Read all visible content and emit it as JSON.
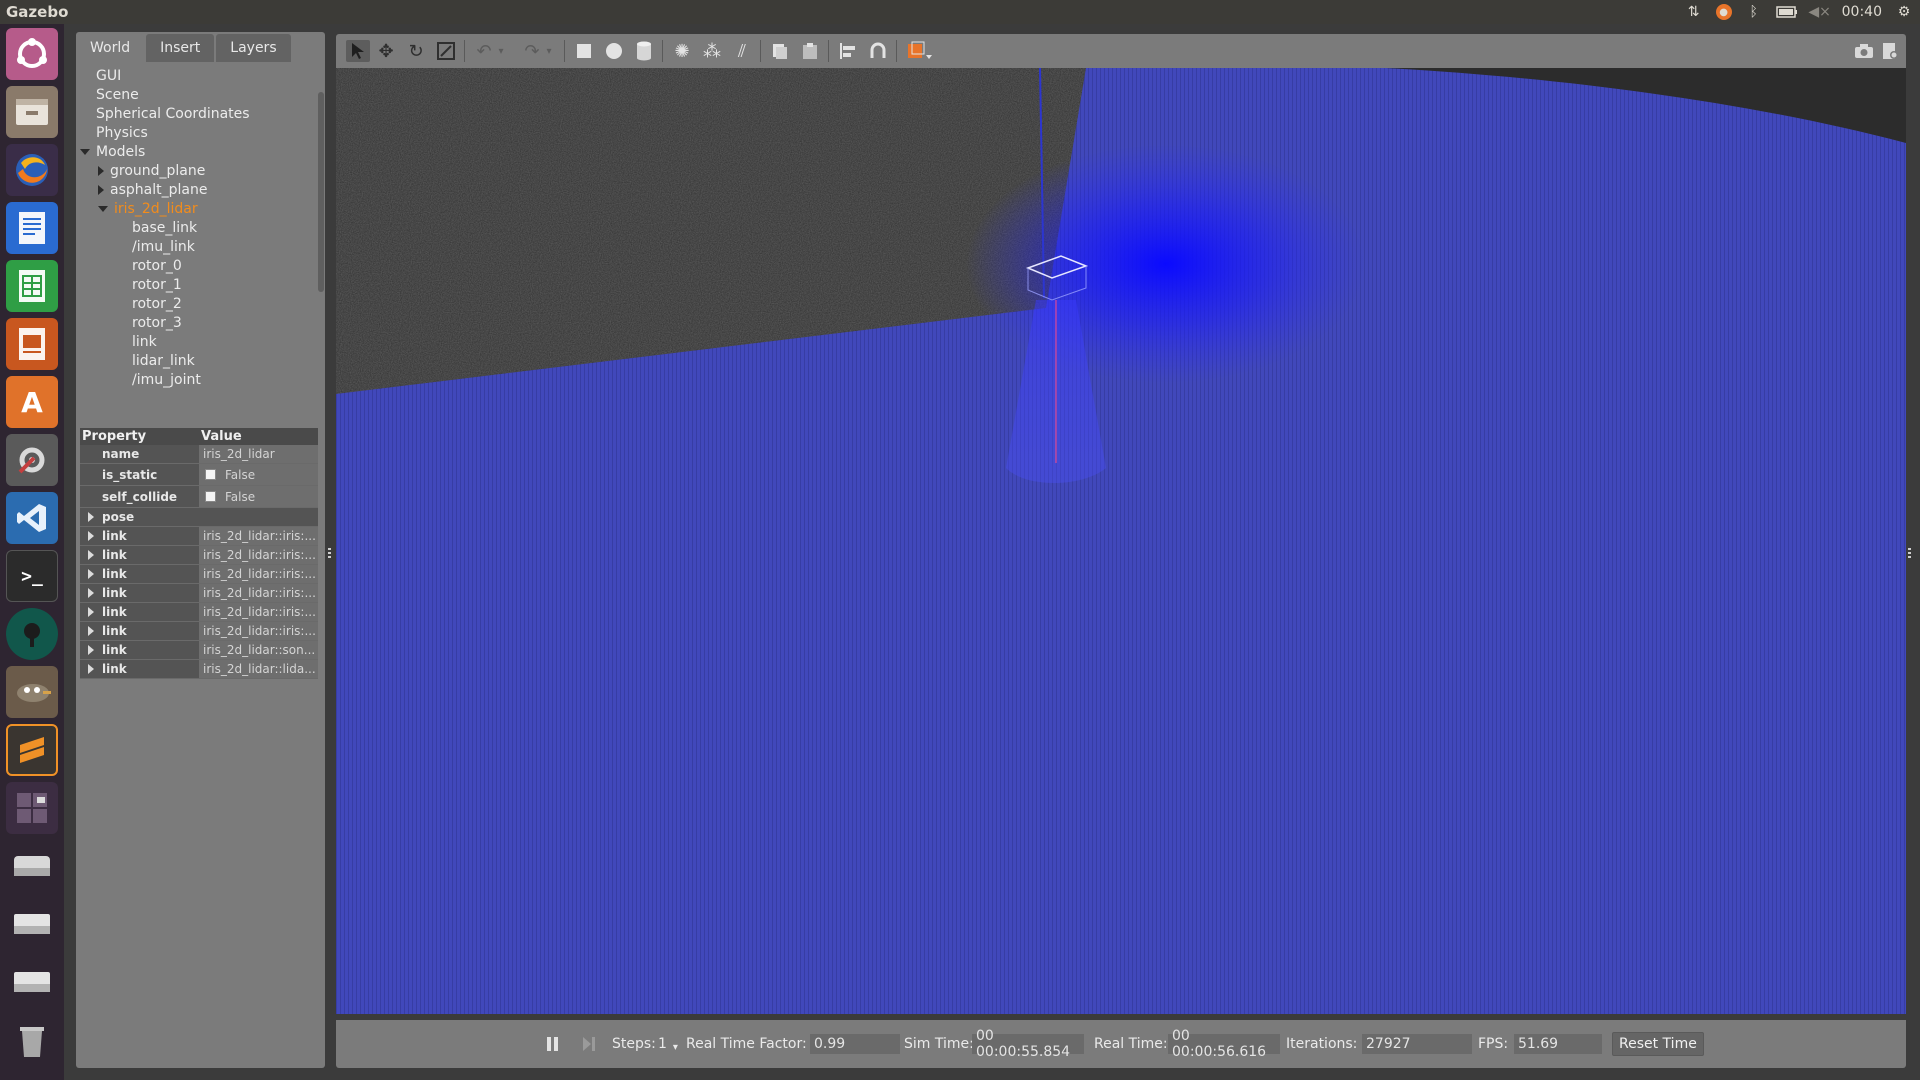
{
  "system": {
    "app_title": "Gazebo",
    "clock": "00:40",
    "tray_icons": [
      "network-updown-icon",
      "software-updater-icon",
      "bluetooth-icon",
      "battery-icon",
      "volume-muted-icon",
      "settings-cog-icon"
    ]
  },
  "launcher": {
    "items": [
      "ubuntu-dash-icon",
      "files-icon",
      "firefox-icon",
      "writer-icon",
      "calc-icon",
      "impress-icon",
      "software-center-icon",
      "system-settings-icon",
      "vscode-icon",
      "terminal-icon",
      "gitkraken-icon",
      "gimp-icon",
      "sublime-icon",
      "workspace-switcher-icon",
      "drive-icon",
      "drive-icon-2",
      "drive-icon-3",
      "trash-icon"
    ],
    "colors": {
      "bg": "#2e2531",
      "ubuntu": "#b65b8a",
      "firefox": "#f07a1d",
      "writer": "#2a6bd1",
      "calc": "#2f9e45",
      "impress": "#c8571f",
      "software": "#e0722a",
      "settings": "#c43f3f",
      "vscode": "#2b6cb0",
      "terminal": "#2b2b2b",
      "gitkraken": "#11574b",
      "gimp": "#6b5b4a",
      "sublime": "#f09127",
      "drive": "#b9b9b9",
      "trash": "#8d8d8d"
    }
  },
  "left_panel": {
    "tabs": [
      {
        "label": "World",
        "active": true
      },
      {
        "label": "Insert",
        "active": false
      },
      {
        "label": "Layers",
        "active": false
      }
    ],
    "tree": [
      {
        "label": "GUI",
        "indent": 0,
        "arrow": "none"
      },
      {
        "label": "Scene",
        "indent": 0,
        "arrow": "none"
      },
      {
        "label": "Spherical Coordinates",
        "indent": 0,
        "arrow": "none"
      },
      {
        "label": "Physics",
        "indent": 0,
        "arrow": "none"
      },
      {
        "label": "Models",
        "indent": 0,
        "arrow": "down"
      },
      {
        "label": "ground_plane",
        "indent": 1,
        "arrow": "right"
      },
      {
        "label": "asphalt_plane",
        "indent": 1,
        "arrow": "right"
      },
      {
        "label": "iris_2d_lidar",
        "indent": 1,
        "arrow": "down",
        "selected": true
      },
      {
        "label": "base_link",
        "indent": 2,
        "arrow": "none"
      },
      {
        "label": "/imu_link",
        "indent": 2,
        "arrow": "none"
      },
      {
        "label": "rotor_0",
        "indent": 2,
        "arrow": "none"
      },
      {
        "label": "rotor_1",
        "indent": 2,
        "arrow": "none"
      },
      {
        "label": "rotor_2",
        "indent": 2,
        "arrow": "none"
      },
      {
        "label": "rotor_3",
        "indent": 2,
        "arrow": "none"
      },
      {
        "label": "link",
        "indent": 2,
        "arrow": "none"
      },
      {
        "label": "lidar_link",
        "indent": 2,
        "arrow": "none"
      },
      {
        "label": "/imu_joint",
        "indent": 2,
        "arrow": "none"
      }
    ],
    "properties": {
      "header_property": "Property",
      "header_value": "Value",
      "rows": [
        {
          "key": "name",
          "value": "iris_2d_lidar",
          "type": "text"
        },
        {
          "key": "is_static",
          "value": "False",
          "type": "checkbox"
        },
        {
          "key": "self_collide",
          "value": "False",
          "type": "checkbox"
        },
        {
          "key": "pose",
          "value": "",
          "type": "group"
        },
        {
          "key": "link",
          "value": "iris_2d_lidar::iris:...",
          "type": "expand"
        },
        {
          "key": "link",
          "value": "iris_2d_lidar::iris:...",
          "type": "expand"
        },
        {
          "key": "link",
          "value": "iris_2d_lidar::iris:...",
          "type": "expand"
        },
        {
          "key": "link",
          "value": "iris_2d_lidar::iris:...",
          "type": "expand"
        },
        {
          "key": "link",
          "value": "iris_2d_lidar::iris:...",
          "type": "expand"
        },
        {
          "key": "link",
          "value": "iris_2d_lidar::iris:...",
          "type": "expand"
        },
        {
          "key": "link",
          "value": "iris_2d_lidar::son...",
          "type": "expand"
        },
        {
          "key": "link",
          "value": "iris_2d_lidar::lida...",
          "type": "expand"
        }
      ]
    }
  },
  "toolbar": {
    "tools": [
      "select-arrow-icon",
      "translate-icon",
      "rotate-icon",
      "scale-icon",
      "undo-icon",
      "undo-dropdown-icon",
      "redo-icon",
      "redo-dropdown-icon",
      "box-shape-icon",
      "sphere-shape-icon",
      "cylinder-shape-icon",
      "point-light-icon",
      "spot-light-icon",
      "directional-light-icon",
      "copy-icon",
      "paste-icon",
      "align-icon",
      "snap-icon",
      "view-angle-icon",
      "screenshot-icon",
      "record-log-icon"
    ]
  },
  "bottom_bar": {
    "steps_label": "Steps:",
    "steps_value": "1",
    "rtf_label": "Real Time Factor:",
    "rtf_value": "0.99",
    "sim_time_label": "Sim Time:",
    "sim_time_value": "00 00:00:55.854",
    "real_time_label": "Real Time:",
    "real_time_value": "00 00:00:56.616",
    "iterations_label": "Iterations:",
    "iterations_value": "27927",
    "fps_label": "FPS:",
    "fps_value": "51.69",
    "reset_label": "Reset Time"
  },
  "scene_colors": {
    "asphalt": "#2b2b2b",
    "lidar_blue": "#2f36b8",
    "lidar_bright": "#1010ff",
    "panel": "#7b7b7b"
  }
}
